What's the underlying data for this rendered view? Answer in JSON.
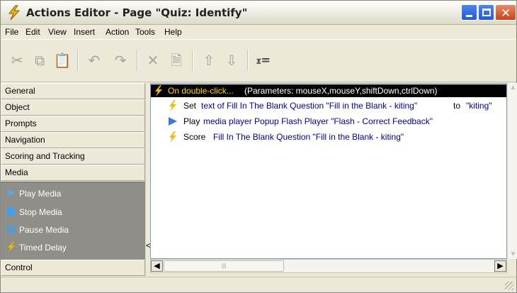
{
  "window": {
    "title": "Actions Editor - Page \"Quiz: Identify\""
  },
  "menu": [
    "File",
    "Edit",
    "View",
    "Insert",
    "Action",
    "Tools",
    "Help"
  ],
  "toolbar": {
    "cut": "✂",
    "copy": "⧉",
    "paste": "📋",
    "undo": "↶",
    "redo": "↷",
    "delete": "✕",
    "properties": "🗎",
    "move_up": "⇧",
    "move_down": "⇩",
    "variables": "𝔵="
  },
  "categories": [
    "General",
    "Object",
    "Prompts",
    "Navigation",
    "Scoring and Tracking",
    "Media",
    "Control"
  ],
  "media_actions": [
    {
      "label": "Play Media",
      "icon": "play-icon"
    },
    {
      "label": "Stop Media",
      "icon": "stop-icon"
    },
    {
      "label": "Pause Media",
      "icon": "pause-icon"
    },
    {
      "label": "Timed Delay",
      "icon": "lightning-icon"
    }
  ],
  "actions": {
    "event": {
      "trigger": "On double-click...",
      "params": " (Parameters: mouseX,mouseY,shiftDown,ctrlDown)"
    },
    "rows": [
      {
        "verb": "Set ",
        "obj1": "text of Fill In The Blank Question \"Fill in the Blank - kiting\"",
        "mid": " to ",
        "obj2": "\"kiting\"",
        "icon": "lightning-icon"
      },
      {
        "verb": "Play ",
        "obj1": "media player Popup Flash Player \"Flash - Correct Feedback\"",
        "mid": "",
        "obj2": "",
        "icon": "play-icon"
      },
      {
        "verb": "Score ",
        "obj1": "Fill In The Blank Question \"Fill in the Blank - kiting\"",
        "mid": "",
        "obj2": "",
        "icon": "lightning-icon"
      }
    ]
  },
  "colors": {
    "lightning": "#f5b800",
    "play_blue": "#3b7ad9",
    "stop_blue": "#3da0f0",
    "link_blue": "#0000a0",
    "selected_bg": "#000000",
    "selected_event": "#ffd800"
  }
}
